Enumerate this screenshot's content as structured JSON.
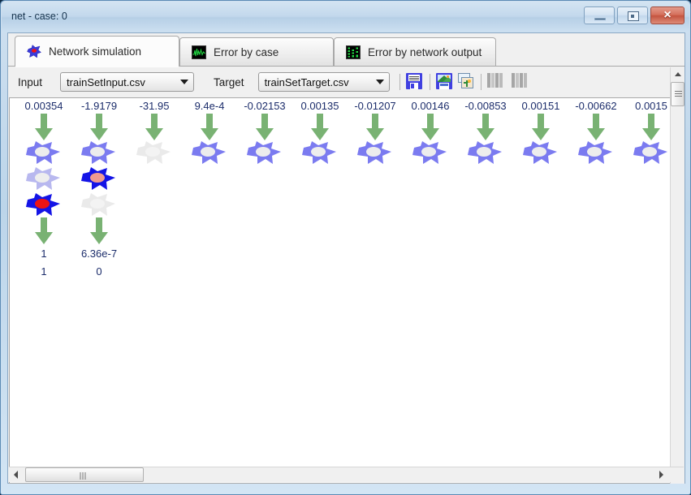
{
  "window": {
    "title": "net - case: 0",
    "buttons": {
      "minimize": "minimize-button",
      "maximize": "maximize-button",
      "close": "×"
    }
  },
  "tabs": [
    {
      "label": "Network simulation",
      "icon": "neuron-star-icon",
      "active": true
    },
    {
      "label": "Error by case",
      "icon": "waveform-chart-icon",
      "active": false
    },
    {
      "label": "Error by network output",
      "icon": "bar-chart-icon",
      "active": false
    }
  ],
  "toolbar": {
    "input_label": "Input",
    "input_value": "trainSetInput.csv",
    "target_label": "Target",
    "target_value": "trainSetTarget.csv",
    "buttons": [
      {
        "name": "save-data-button",
        "icon": "floppy-disk-icon",
        "enabled": true
      },
      {
        "name": "save-image-button",
        "icon": "save-picture-icon",
        "enabled": true
      },
      {
        "name": "copy-images-button",
        "icon": "multiple-pictures-icon",
        "enabled": true
      },
      {
        "name": "columns-button-1",
        "icon": "grey-columns-icon",
        "enabled": false
      },
      {
        "name": "columns-button-2",
        "icon": "grey-columns-icon",
        "enabled": false
      }
    ]
  },
  "colors": {
    "highlight_green": "#aadba5",
    "arrow_green": "#79b273",
    "neuron_blue": "#7b7bf0",
    "neuron_active_blue": "#1414e6",
    "neuron_inactive": "#e8e8e8",
    "nucleus_red": "#ee1414",
    "nucleus_pink": "#f09a90",
    "value_text": "#1c2d6b"
  },
  "network": {
    "input_values": [
      "0.00354",
      "-1.9179",
      "-31.95",
      "9.4e-4",
      "-0.02153",
      "0.00135",
      "-0.01207",
      "0.00146",
      "-0.00853",
      "0.00151",
      "-0.00662",
      "0.0015"
    ],
    "highlighted_input_index": 0,
    "hidden_layer_1": [
      "active",
      "active",
      "inactive",
      "active",
      "active",
      "active",
      "active",
      "active",
      "active",
      "active",
      "active",
      "active"
    ],
    "hidden_layer_2": [
      "faded",
      "selected",
      null,
      null,
      null,
      null,
      null,
      null,
      null,
      null,
      null,
      null
    ],
    "output_layer": [
      "fired",
      "inactive",
      null,
      null,
      null,
      null,
      null,
      null,
      null,
      null,
      null,
      null
    ],
    "output_values": [
      "1",
      "6.36e-7"
    ],
    "target_values": [
      "1",
      "0"
    ]
  },
  "scrollbars": {
    "vertical": "vertical-scrollbar",
    "horizontal": "horizontal-scrollbar"
  }
}
